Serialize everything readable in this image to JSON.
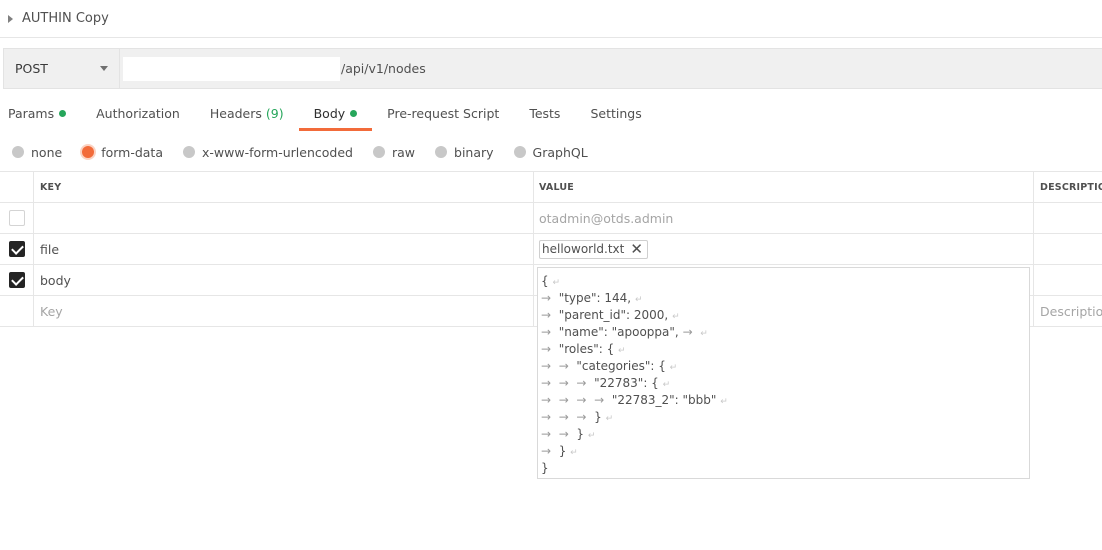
{
  "collection": {
    "title": "AUTHIN Copy"
  },
  "request": {
    "method": "POST",
    "url": "/api/v1/nodes"
  },
  "tabs": [
    {
      "label": "Params",
      "dot": true
    },
    {
      "label": "Authorization"
    },
    {
      "label": "Headers",
      "count": "(9)"
    },
    {
      "label": "Body",
      "dot": true,
      "active": true
    },
    {
      "label": "Pre-request Script"
    },
    {
      "label": "Tests"
    },
    {
      "label": "Settings"
    }
  ],
  "body_types": [
    {
      "label": "none",
      "selected": false
    },
    {
      "label": "form-data",
      "selected": true
    },
    {
      "label": "x-www-form-urlencoded",
      "selected": false
    },
    {
      "label": "raw",
      "selected": false
    },
    {
      "label": "binary",
      "selected": false
    },
    {
      "label": "GraphQL",
      "selected": false
    }
  ],
  "table": {
    "headers": {
      "key": "KEY",
      "value": "VALUE",
      "description": "DESCRIPTION"
    },
    "rows": [
      {
        "checked": false,
        "key": "",
        "value_placeholder": "otadmin@otds.admin"
      },
      {
        "checked": true,
        "key": "file",
        "file": "helloworld.txt"
      },
      {
        "checked": true,
        "key": "body"
      }
    ],
    "new_row": {
      "key_placeholder": "Key",
      "description_placeholder": "Description"
    }
  },
  "body_json_lines": [
    "{",
    "\"type\": 144,",
    "\"parent_id\": 2000,",
    "\"name\": \"apooppa\",",
    "\"roles\": {",
    "\"categories\": {",
    "\"22783\": {",
    "\"22783_2\": \"bbb\"",
    "}",
    "}",
    "}",
    "}"
  ],
  "colors": {
    "accent": "#f26b3a",
    "dot_green": "#26a65b"
  },
  "icons": {
    "collapse": "caret-right-icon",
    "method_dropdown": "chevron-down-icon",
    "remove_file": "close-icon"
  }
}
